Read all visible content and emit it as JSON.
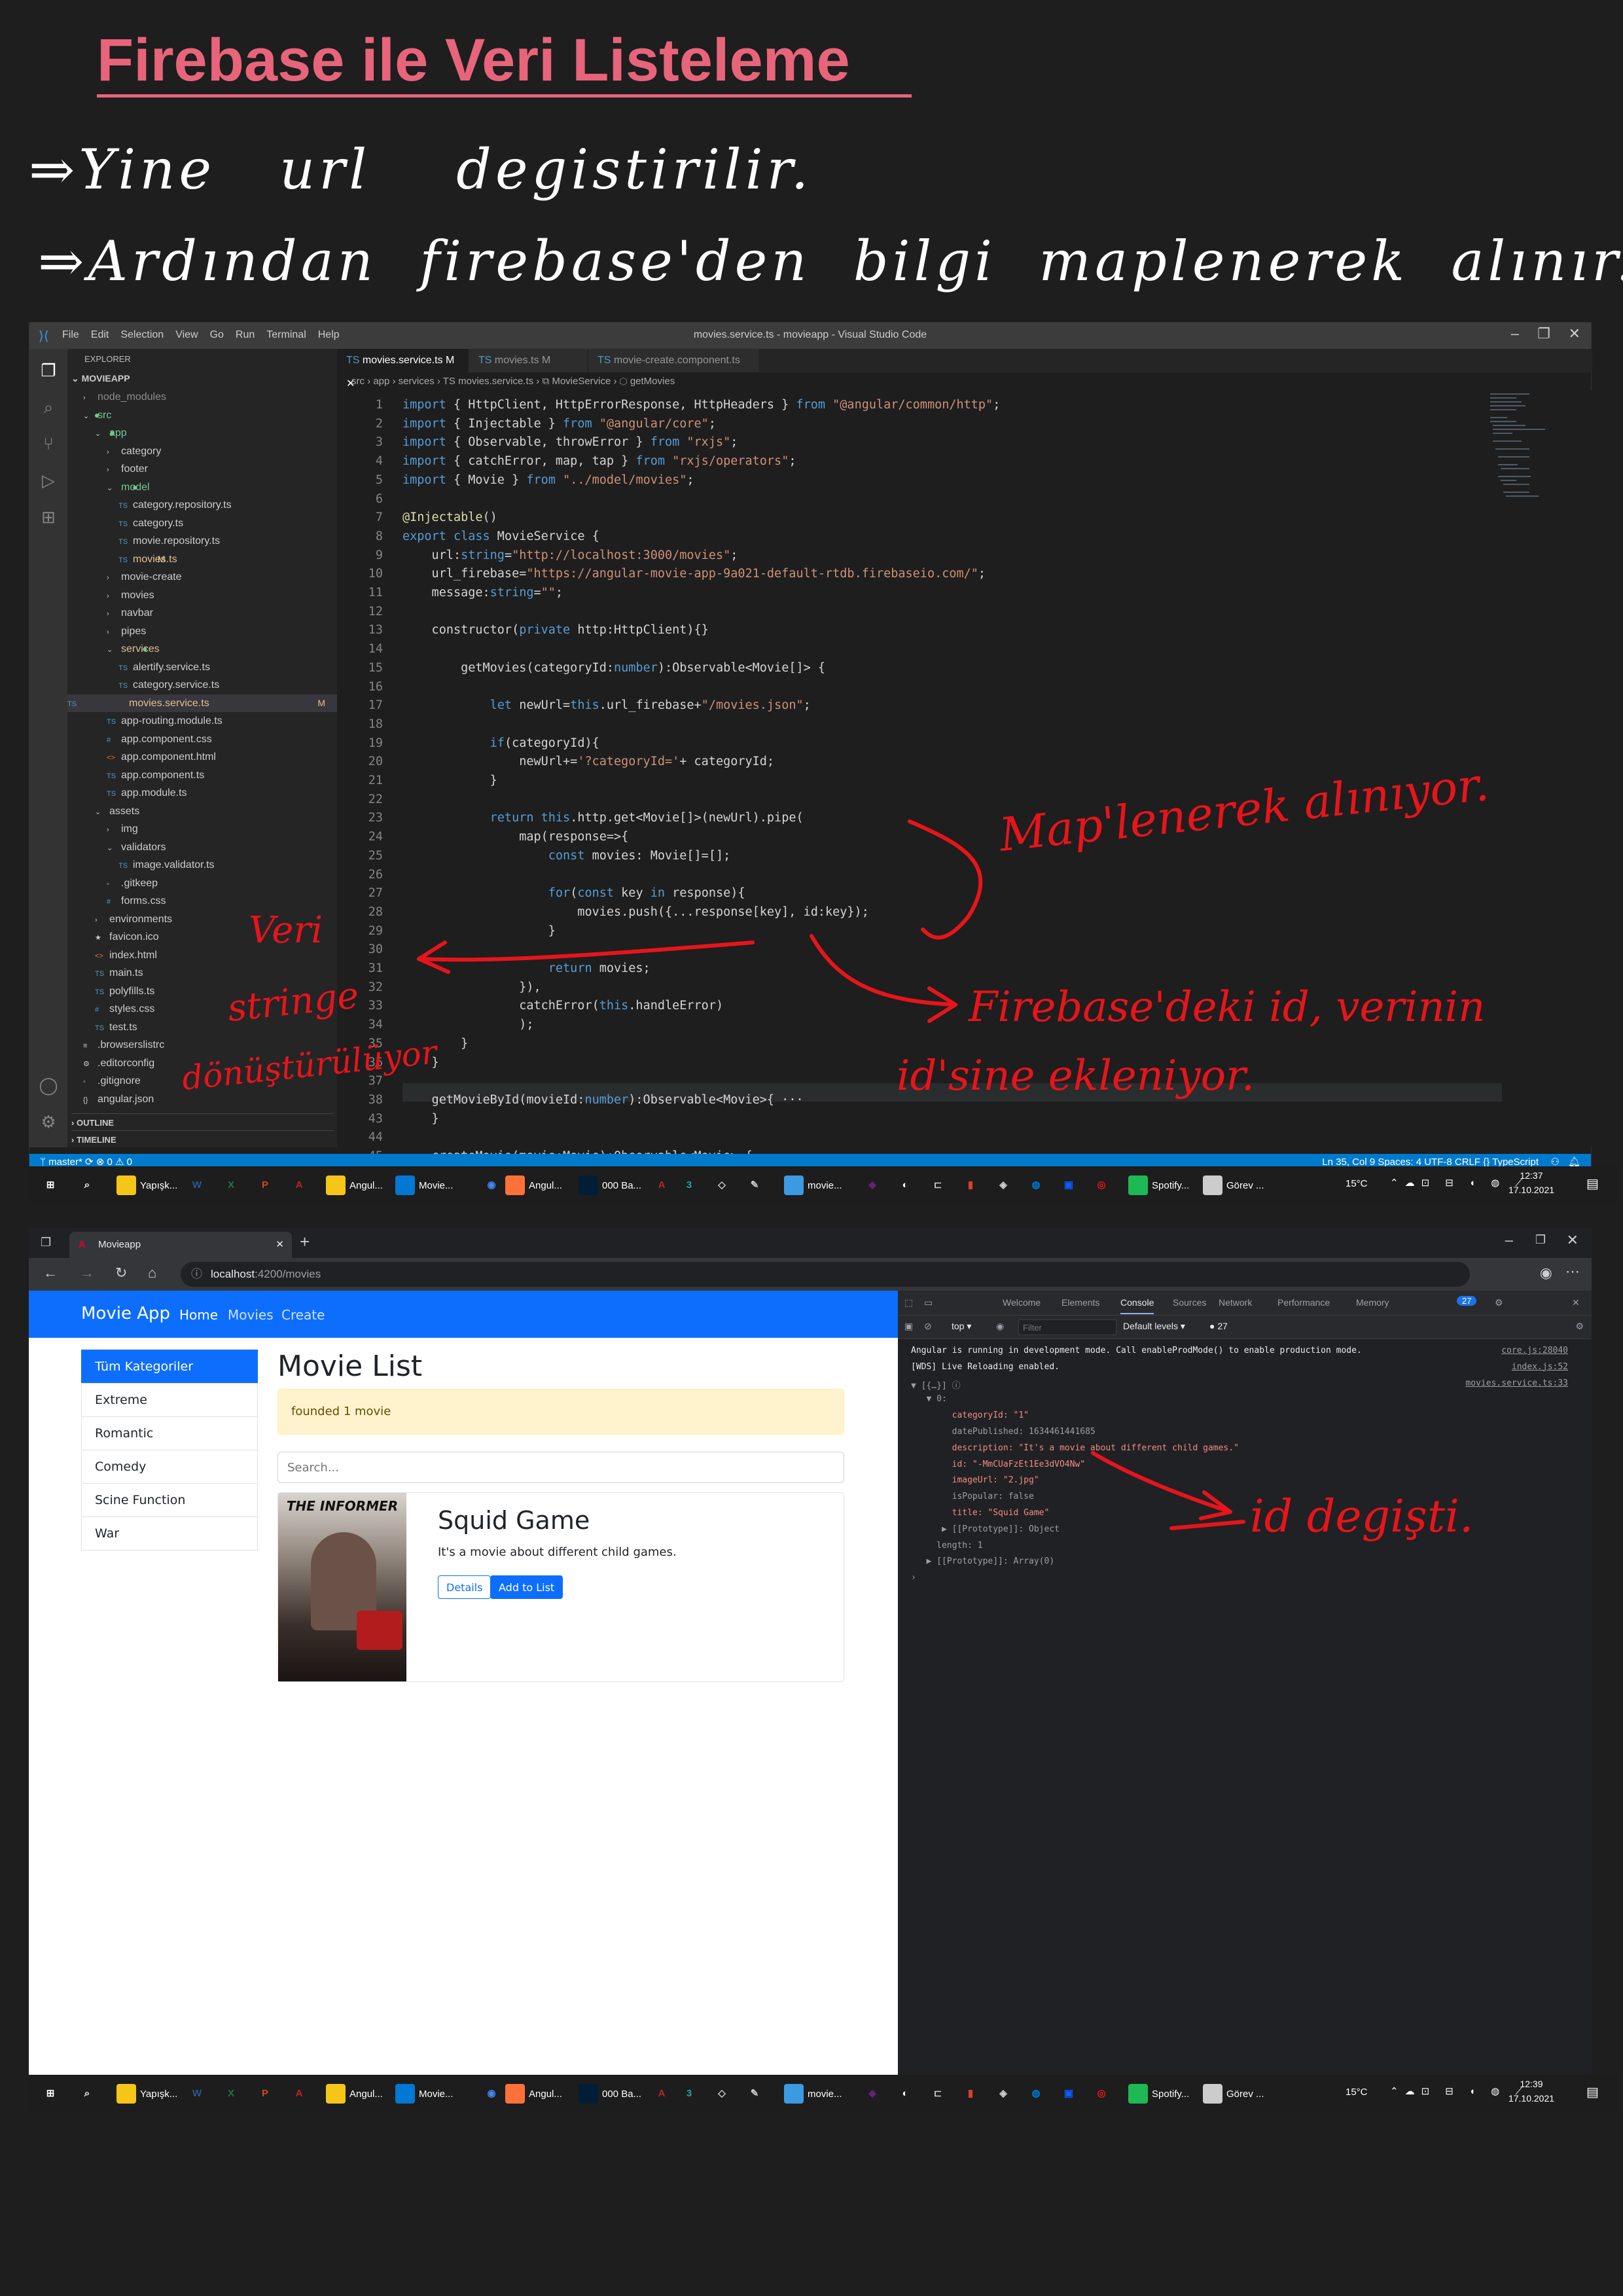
{
  "notes": {
    "title": "Firebase ile Veri Listeleme",
    "line1": "⇒Yine   url    degistirilir.",
    "line2": "⇒Ardından  firebase'den  bilgi  maplenerek  alınır.",
    "anno_map": "Map'lenerek alınıyor.",
    "anno_fb1": "Firebase'deki id, verinin",
    "anno_fb2": "id'sine ekleniyor.",
    "anno_veri1": "Veri",
    "anno_veri2": "stringe",
    "anno_veri3": "dönüştürülüyor",
    "anno_id": "id degişti."
  },
  "vscode": {
    "menu": [
      "File",
      "Edit",
      "Selection",
      "View",
      "Go",
      "Run",
      "Terminal",
      "Help"
    ],
    "window_title": "movies.service.ts - movieapp - Visual Studio Code",
    "explorer_title": "EXPLORER",
    "project": "MOVIEAPP",
    "tree": [
      {
        "label": "node_modules",
        "ind": 1,
        "c": "#8b8b8b",
        "ic": "›"
      },
      {
        "label": "src",
        "ind": 1,
        "c": "#73c991",
        "ic": "⌄",
        "m": "●"
      },
      {
        "label": "app",
        "ind": 2,
        "c": "#73c991",
        "ic": "⌄",
        "m": "●"
      },
      {
        "label": "category",
        "ind": 3,
        "c": "#ccc",
        "ic": "›"
      },
      {
        "label": "footer",
        "ind": 3,
        "c": "#ccc",
        "ic": "›"
      },
      {
        "label": "model",
        "ind": 3,
        "c": "#73c991",
        "ic": "⌄",
        "m": "●"
      },
      {
        "label": "category.repository.ts",
        "ind": 4,
        "c": "#ccc",
        "ic": "TS"
      },
      {
        "label": "category.ts",
        "ind": 4,
        "c": "#ccc",
        "ic": "TS"
      },
      {
        "label": "movie.repository.ts",
        "ind": 4,
        "c": "#ccc",
        "ic": "TS"
      },
      {
        "label": "movies.ts",
        "ind": 4,
        "c": "#e2c08d",
        "ic": "TS",
        "m": "M"
      },
      {
        "label": "movie-create",
        "ind": 3,
        "c": "#ccc",
        "ic": "›"
      },
      {
        "label": "movies",
        "ind": 3,
        "c": "#ccc",
        "ic": "›"
      },
      {
        "label": "navbar",
        "ind": 3,
        "c": "#ccc",
        "ic": "›"
      },
      {
        "label": "pipes",
        "ind": 3,
        "c": "#ccc",
        "ic": "›"
      },
      {
        "label": "services",
        "ind": 3,
        "c": "#e2c08d",
        "ic": "⌄",
        "m": "●"
      },
      {
        "label": "alertify.service.ts",
        "ind": 4,
        "c": "#ccc",
        "ic": "TS"
      },
      {
        "label": "category.service.ts",
        "ind": 4,
        "c": "#ccc",
        "ic": "TS"
      },
      {
        "label": "movies.service.ts",
        "ind": 4,
        "c": "#e2c08d",
        "ic": "TS",
        "m": "M",
        "sel": true
      },
      {
        "label": "app-routing.module.ts",
        "ind": 3,
        "c": "#ccc",
        "ic": "TS"
      },
      {
        "label": "app.component.css",
        "ind": 3,
        "c": "#ccc",
        "ic": "#"
      },
      {
        "label": "app.component.html",
        "ind": 3,
        "c": "#ccc",
        "ic": "<>"
      },
      {
        "label": "app.component.ts",
        "ind": 3,
        "c": "#ccc",
        "ic": "TS"
      },
      {
        "label": "app.module.ts",
        "ind": 3,
        "c": "#ccc",
        "ic": "TS"
      },
      {
        "label": "assets",
        "ind": 2,
        "c": "#ccc",
        "ic": "⌄"
      },
      {
        "label": "img",
        "ind": 3,
        "c": "#ccc",
        "ic": "›"
      },
      {
        "label": "validators",
        "ind": 3,
        "c": "#ccc",
        "ic": "⌄"
      },
      {
        "label": "image.validator.ts",
        "ind": 4,
        "c": "#ccc",
        "ic": "TS"
      },
      {
        "label": ".gitkeep",
        "ind": 3,
        "c": "#ccc",
        "ic": "◦"
      },
      {
        "label": "forms.css",
        "ind": 3,
        "c": "#ccc",
        "ic": "#"
      },
      {
        "label": "environments",
        "ind": 2,
        "c": "#ccc",
        "ic": "›"
      },
      {
        "label": "favicon.ico",
        "ind": 2,
        "c": "#ccc",
        "ic": "★"
      },
      {
        "label": "index.html",
        "ind": 2,
        "c": "#ccc",
        "ic": "<>"
      },
      {
        "label": "main.ts",
        "ind": 2,
        "c": "#ccc",
        "ic": "TS"
      },
      {
        "label": "polyfills.ts",
        "ind": 2,
        "c": "#ccc",
        "ic": "TS"
      },
      {
        "label": "styles.css",
        "ind": 2,
        "c": "#ccc",
        "ic": "#"
      },
      {
        "label": "test.ts",
        "ind": 2,
        "c": "#ccc",
        "ic": "TS"
      },
      {
        "label": ".browserslistrc",
        "ind": 1,
        "c": "#ccc",
        "ic": "≡"
      },
      {
        "label": ".editorconfig",
        "ind": 1,
        "c": "#ccc",
        "ic": "⚙"
      },
      {
        "label": ".gitignore",
        "ind": 1,
        "c": "#ccc",
        "ic": "◦"
      },
      {
        "label": "angular.json",
        "ind": 1,
        "c": "#ccc",
        "ic": "{}"
      }
    ],
    "outline": "OUTLINE",
    "timeline": "TIMELINE",
    "tabs": [
      "movies.service.ts  M",
      "movies.ts  M",
      "movie-create.component.ts"
    ],
    "breadcrumb": "src › app › services › TS movies.service.ts › ⧉ MovieService › ⬡ getMovies",
    "lines": [
      [
        "1",
        "import { HttpClient, HttpErrorResponse, HttpHeaders } from \"@angular/common/http\";"
      ],
      [
        "2",
        "import { Injectable } from \"@angular/core\";"
      ],
      [
        "3",
        "import { Observable, throwError } from \"rxjs\";"
      ],
      [
        "4",
        "import { catchError, map, tap } from \"rxjs/operators\";"
      ],
      [
        "5",
        "import { Movie } from \"../model/movies\";"
      ],
      [
        "6",
        ""
      ],
      [
        "7",
        "@Injectable()"
      ],
      [
        "8",
        "export class MovieService {"
      ],
      [
        "9",
        "    url:string=\"http://localhost:3000/movies\";"
      ],
      [
        "10",
        "    url_firebase=\"https://angular-movie-app-9a021-default-rtdb.firebaseio.com/\";"
      ],
      [
        "11",
        "    message:string=\"\";"
      ],
      [
        "12",
        ""
      ],
      [
        "13",
        "    constructor(private http:HttpClient){}"
      ],
      [
        "14",
        ""
      ],
      [
        "15",
        "        getMovies(categoryId:number):Observable<Movie[]> {"
      ],
      [
        "16",
        ""
      ],
      [
        "17",
        "            let newUrl=this.url_firebase+\"/movies.json\";"
      ],
      [
        "18",
        ""
      ],
      [
        "19",
        "            if(categoryId){"
      ],
      [
        "20",
        "                newUrl+='?categoryId='+ categoryId;"
      ],
      [
        "21",
        "            }"
      ],
      [
        "22",
        ""
      ],
      [
        "23",
        "            return this.http.get<Movie[]>(newUrl).pipe("
      ],
      [
        "24",
        "                map(response=>{"
      ],
      [
        "25",
        "                    const movies: Movie[]=[];"
      ],
      [
        "26",
        ""
      ],
      [
        "27",
        "                    for(const key in response){"
      ],
      [
        "28",
        "                        movies.push({...response[key], id:key});"
      ],
      [
        "29",
        "                    }"
      ],
      [
        "30",
        ""
      ],
      [
        "31",
        "                    return movies;"
      ],
      [
        "32",
        "                }),"
      ],
      [
        "33",
        "                catchError(this.handleError)"
      ],
      [
        "34",
        "                );"
      ],
      [
        "35",
        "        }"
      ],
      [
        "36",
        "    }"
      ],
      [
        "37",
        ""
      ],
      [
        "38",
        "    getMovieById(movieId:number):Observable<Movie>{ ···"
      ],
      [
        "43",
        "    }"
      ],
      [
        "44",
        ""
      ],
      [
        "45",
        "    createMovie(movie:Movie):Observable<Movie> {"
      ]
    ],
    "status_left": "ᛘ master*   ⟳   ⊗ 0 ⚠ 0",
    "status_right": "Ln 35, Col 9    Spaces: 4    UTF-8    CRLF    {} TypeScript"
  },
  "taskbar1": {
    "time": "12:37",
    "date": "17.10.2021",
    "temp": "15°C"
  },
  "taskbar2": {
    "time": "12:39",
    "date": "17.10.2021",
    "temp": "15°C"
  },
  "taskbar_apps": [
    "Yapışk...",
    "Angul...",
    "Movie...",
    "Angul...",
    "000 Ba...",
    "movie...",
    "Spotify...",
    "Görev ..."
  ],
  "browser": {
    "tab": "Movieapp",
    "url_host": "localhost",
    "url_path": ":4200/movies",
    "app": {
      "brand": "Movie App",
      "nav": [
        "Home",
        "Movies",
        "Create"
      ],
      "categories": [
        "Tüm Kategoriler",
        "Extreme",
        "Romantic",
        "Comedy",
        "Scine Function",
        "War"
      ],
      "heading": "Movie List",
      "alert": "founded 1 movie",
      "search_ph": "Search...",
      "movie": {
        "title": "Squid Game",
        "desc": "It's a movie about different child games.",
        "btn_details": "Details",
        "btn_add": "Add to List",
        "poster_title": "THE INFORMER"
      }
    },
    "devtools": {
      "tabs": [
        "Welcome",
        "Elements",
        "Console",
        "Sources",
        "Network",
        "Performance",
        "Memory"
      ],
      "badge": "27",
      "context": "top",
      "filter_ph": "Filter",
      "levels": "Default levels",
      "issues": "27",
      "console": [
        {
          "t": "Angular is running in development mode. Call enableProdMode() to enable production mode.",
          "s": "core.js:28040"
        },
        {
          "t": "[WDS] Live Reloading enabled.",
          "s": "index.js:52"
        },
        {
          "t": "▼ [{…}] ⓘ",
          "s": "movies.service.ts:33"
        },
        {
          "t": "   ▼ 0:"
        },
        {
          "t": "        categoryId: \"1\""
        },
        {
          "t": "        datePublished: 1634461441685"
        },
        {
          "t": "        description: \"It's a movie about different child games.\""
        },
        {
          "t": "        id: \"-MmCUaFzEt1Ee3dVO4Nw\""
        },
        {
          "t": "        imageUrl: \"2.jpg\""
        },
        {
          "t": "        isPopular: false"
        },
        {
          "t": "        title: \"Squid Game\""
        },
        {
          "t": "      ▶ [[Prototype]]: Object"
        },
        {
          "t": "     length: 1"
        },
        {
          "t": "   ▶ [[Prototype]]: Array(0)"
        },
        {
          "t": "›"
        }
      ]
    }
  }
}
